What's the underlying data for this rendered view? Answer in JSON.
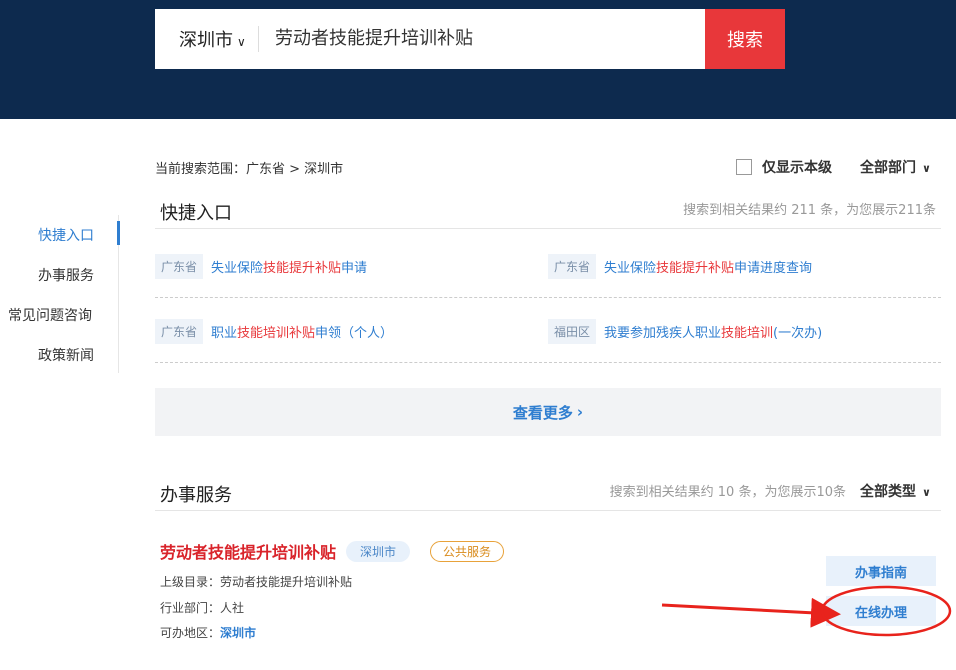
{
  "search": {
    "city": "深圳市",
    "query": "劳动者技能提升培训补贴",
    "button": "搜索"
  },
  "sidenav": {
    "items": [
      "快捷入口",
      "办事服务",
      "常见问题咨询",
      "政策新闻"
    ]
  },
  "scope": {
    "text": "当前搜索范围：广东省 > 深圳市",
    "only_local": "仅显示本级",
    "all_depts": "全部部门"
  },
  "quick": {
    "title": "快捷入口",
    "count": "搜索到相关结果约 211 条，为您展示211条",
    "links": [
      {
        "tag": "广东省",
        "pre": "失业保险",
        "hl": "技能提升补贴",
        "post": "申请"
      },
      {
        "tag": "广东省",
        "pre": "失业保险",
        "hl": "技能提升补贴",
        "post": "申请进度查询"
      },
      {
        "tag": "广东省",
        "pre": "职业",
        "hl": "技能培训补贴",
        "post": "申领（个人）"
      },
      {
        "tag": "福田区",
        "pre": "我要参加残疾人职业",
        "hl": "技能培训",
        "post": "(一次办)"
      }
    ],
    "more": "查看更多"
  },
  "services": {
    "title": "办事服务",
    "count": "搜索到相关结果约 10 条，为您展示10条",
    "all_types": "全部类型",
    "item": {
      "title": "劳动者技能提升培训补贴",
      "badge_city": "深圳市",
      "badge_type": "公共服务",
      "parent_label": "上级目录：",
      "parent": "劳动者技能提升培训补贴",
      "dept_label": "行业部门：",
      "dept": "人社",
      "region_label": "可办地区：",
      "region": "深圳市",
      "guide_btn": "办事指南",
      "online_btn": "在线办理"
    }
  },
  "colors": {
    "header_bg": "#0d2a4e",
    "accent_red": "#e8373a",
    "link_blue": "#2f7ed0"
  }
}
